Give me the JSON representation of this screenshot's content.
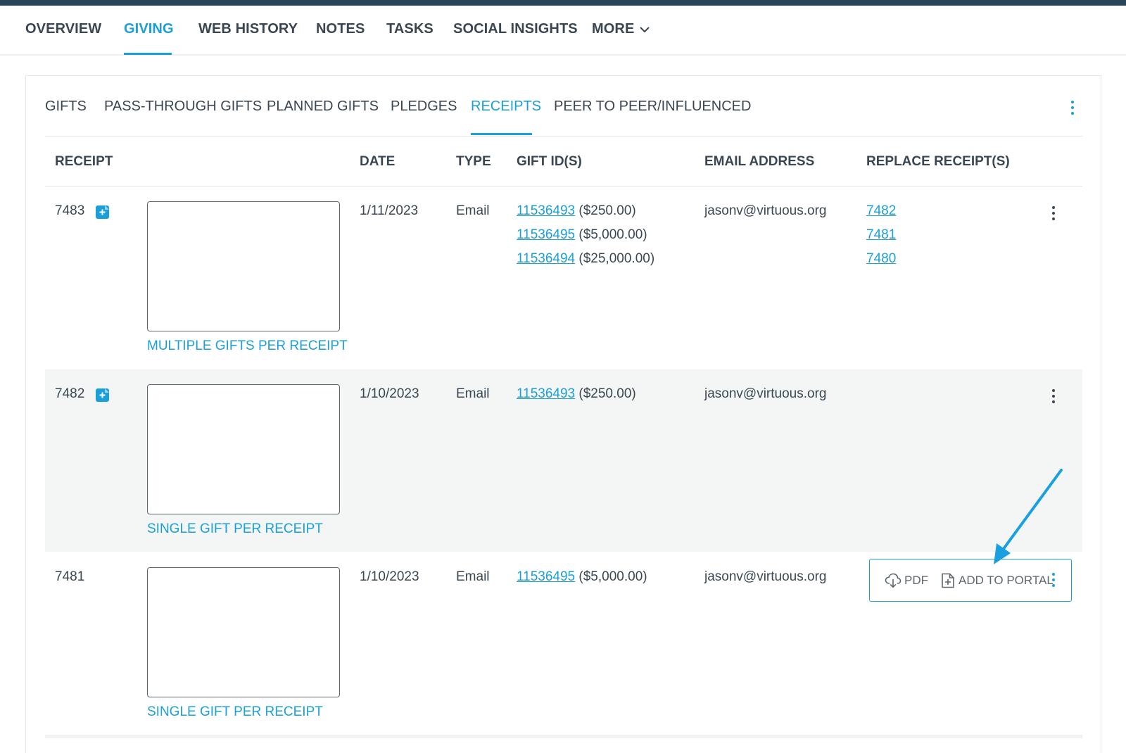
{
  "main_tabs": [
    {
      "label": "OVERVIEW",
      "active": false
    },
    {
      "label": "GIVING",
      "active": true
    },
    {
      "label": "WEB HISTORY",
      "active": false
    },
    {
      "label": "NOTES",
      "active": false
    },
    {
      "label": "TASKS",
      "active": false
    },
    {
      "label": "SOCIAL INSIGHTS",
      "active": false
    },
    {
      "label": "MORE",
      "active": false
    }
  ],
  "sub_tabs": [
    {
      "label": "GIFTS",
      "active": false
    },
    {
      "label": "PASS-THROUGH GIFTS",
      "active": false
    },
    {
      "label": "PLANNED GIFTS",
      "active": false
    },
    {
      "label": "PLEDGES",
      "active": false
    },
    {
      "label": "RECEIPTS",
      "active": true
    },
    {
      "label": "PEER TO PEER/INFLUENCED",
      "active": false
    }
  ],
  "table": {
    "headers": [
      "RECEIPT",
      "DATE",
      "TYPE",
      "GIFT ID(S)",
      "EMAIL ADDRESS",
      "REPLACE RECEIPT(S)"
    ],
    "rows": [
      {
        "receipt": "7483",
        "has_add_icon": true,
        "caption": "MULTIPLE GIFTS PER RECEIPT",
        "date": "1/11/2023",
        "type": "Email",
        "gifts": [
          {
            "id": "11536493",
            "amount": "($250.00)"
          },
          {
            "id": "11536495",
            "amount": "($5,000.00)"
          },
          {
            "id": "11536494",
            "amount": "($25,000.00)"
          }
        ],
        "email": "jasonv@virtuous.org",
        "replace": [
          "7482",
          "7481",
          "7480"
        ]
      },
      {
        "receipt": "7482",
        "has_add_icon": true,
        "caption": "SINGLE GIFT PER RECEIPT",
        "date": "1/10/2023",
        "type": "Email",
        "gifts": [
          {
            "id": "11536493",
            "amount": "($250.00)"
          }
        ],
        "email": "jasonv@virtuous.org",
        "replace": []
      },
      {
        "receipt": "7481",
        "has_add_icon": false,
        "caption": "SINGLE GIFT PER RECEIPT",
        "date": "1/10/2023",
        "type": "Email",
        "gifts": [
          {
            "id": "11536495",
            "amount": "($5,000.00)"
          }
        ],
        "email": "jasonv@virtuous.org",
        "replace": []
      }
    ]
  },
  "action_menu": {
    "pdf_label": "PDF",
    "portal_label": "ADD TO PORTAL"
  },
  "icons": {
    "more_tab": "chevron-down-icon",
    "add_receipt": "add-file-icon",
    "kebab": "kebab-menu-icon",
    "pdf": "cloud-download-icon",
    "portal": "file-plus-icon",
    "annotation": "arrow-annotation"
  },
  "colors": {
    "accent": "#1a9fd9",
    "topbar": "#2b4558",
    "text": "#3a4752",
    "row_alt": "#f4f6f6"
  }
}
